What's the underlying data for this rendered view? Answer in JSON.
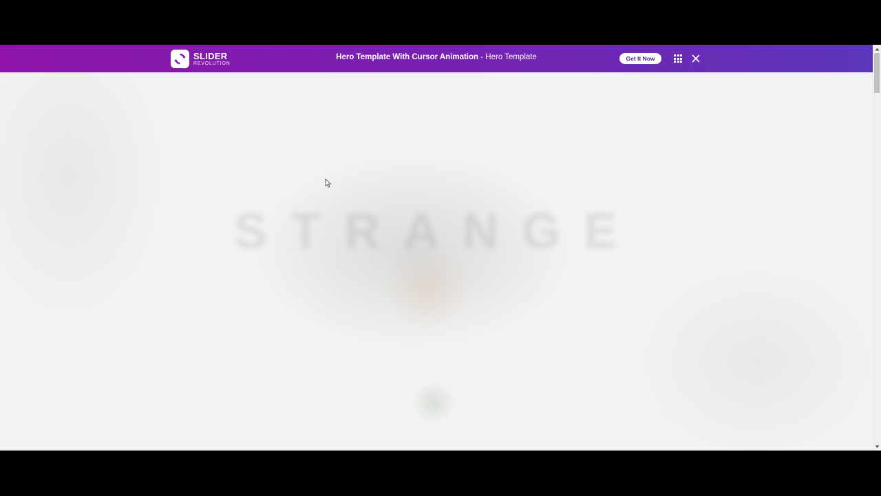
{
  "topbar": {
    "logo_name": "SLIDER",
    "logo_sub": "REVOLUTION",
    "title_strong": "Hero Template With Cursor Animation",
    "title_rest": " - Hero Template",
    "get_button": "Get It Now",
    "grid_icon": "grid-icon",
    "close_icon": "close-icon",
    "gradient_colors": [
      "#8e14a9",
      "#5b36b8"
    ]
  },
  "hero": {
    "word": "STRANGE"
  },
  "colors": {
    "background": "#f2f2f1",
    "letterbox": "#000000",
    "button_text": "#4b1fa0"
  }
}
